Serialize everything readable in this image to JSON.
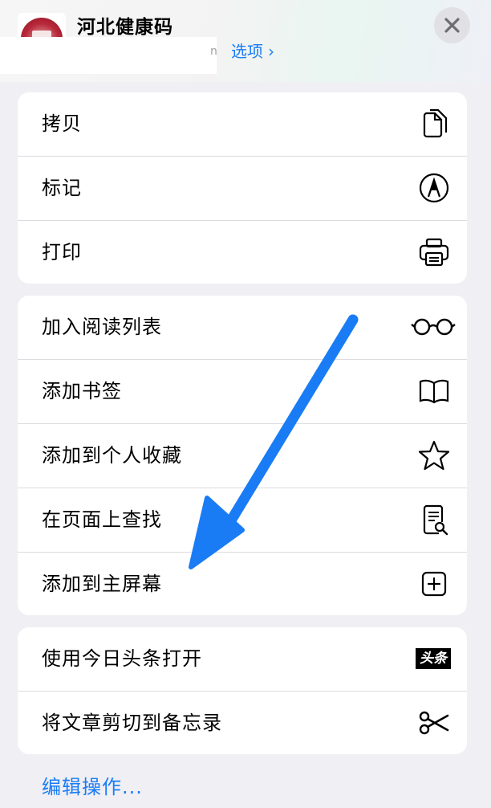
{
  "header": {
    "title": "河北健康码",
    "options_label": "选项",
    "options_chevron": "›",
    "redacted_tail": "n"
  },
  "groups": [
    {
      "items": [
        {
          "label": "拷贝",
          "icon": "copy-icon"
        },
        {
          "label": "标记",
          "icon": "markup-icon"
        },
        {
          "label": "打印",
          "icon": "printer-icon"
        }
      ]
    },
    {
      "items": [
        {
          "label": "加入阅读列表",
          "icon": "glasses-icon"
        },
        {
          "label": "添加书签",
          "icon": "book-icon"
        },
        {
          "label": "添加到个人收藏",
          "icon": "star-icon"
        },
        {
          "label": "在页面上查找",
          "icon": "find-in-page-icon"
        },
        {
          "label": "添加到主屏幕",
          "icon": "add-square-icon"
        }
      ]
    },
    {
      "items": [
        {
          "label": "使用今日头条打开",
          "icon": "toutiao-icon",
          "icon_text": "头条"
        },
        {
          "label": "将文章剪切到备忘录",
          "icon": "scissors-icon"
        }
      ]
    }
  ],
  "edit_actions_label": "编辑操作...",
  "colors": {
    "accent": "#1a7cf5",
    "arrow": "#1a7cf5"
  }
}
